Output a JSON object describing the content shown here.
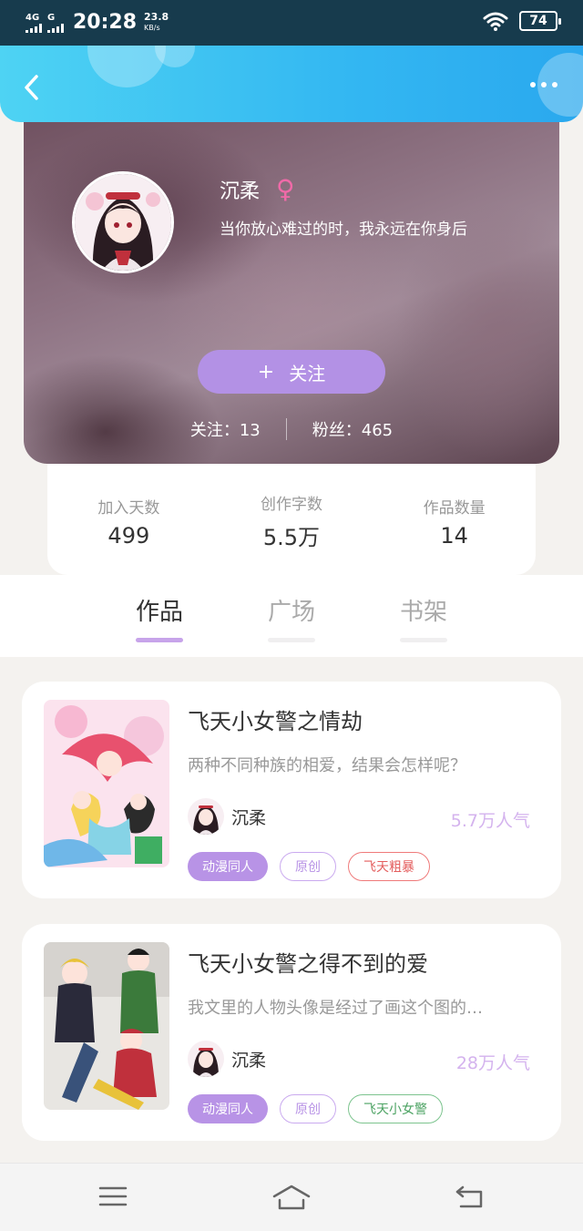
{
  "status_bar": {
    "network_1": "4G",
    "network_2": "G",
    "time": "20:28",
    "speed_value": "23.8",
    "speed_unit": "KB/s",
    "battery": "74",
    "wifi_icon": "wifi-icon"
  },
  "nav": {
    "back_icon": "chevron-left-icon",
    "more_icon": "more-dots-icon"
  },
  "profile": {
    "name": "沉柔",
    "gender_symbol": "♀",
    "bio": "当你放心难过的时，我永远在你身后",
    "follow_plus": "+",
    "follow_label": "关注",
    "following": "关注：13",
    "followers": "粉丝：465"
  },
  "stats": [
    {
      "label": "加入天数",
      "value": "499"
    },
    {
      "label": "创作字数",
      "value": "5.5万"
    },
    {
      "label": "作品数量",
      "value": "14"
    }
  ],
  "tabs": [
    {
      "label": "作品",
      "active": true
    },
    {
      "label": "广场",
      "active": false
    },
    {
      "label": "书架",
      "active": false
    }
  ],
  "books": [
    {
      "title": "飞天小女警之情劫",
      "description": "两种不同种族的相爱，结果会怎样呢？",
      "author": "沉柔",
      "popularity": "5.7万人气",
      "tags": [
        "动漫同人",
        "原创",
        "飞天粗暴"
      ]
    },
    {
      "title": "飞天小女警之得不到的爱",
      "description": "我文里的人物头像是经过了画这个图的…",
      "author": "沉柔",
      "popularity": "28万人气",
      "tags": [
        "动漫同人",
        "原创",
        "飞天小女警"
      ]
    }
  ],
  "bottom_nav": {
    "menu_icon": "menu-icon",
    "home_icon": "home-icon",
    "back_icon": "return-icon"
  }
}
